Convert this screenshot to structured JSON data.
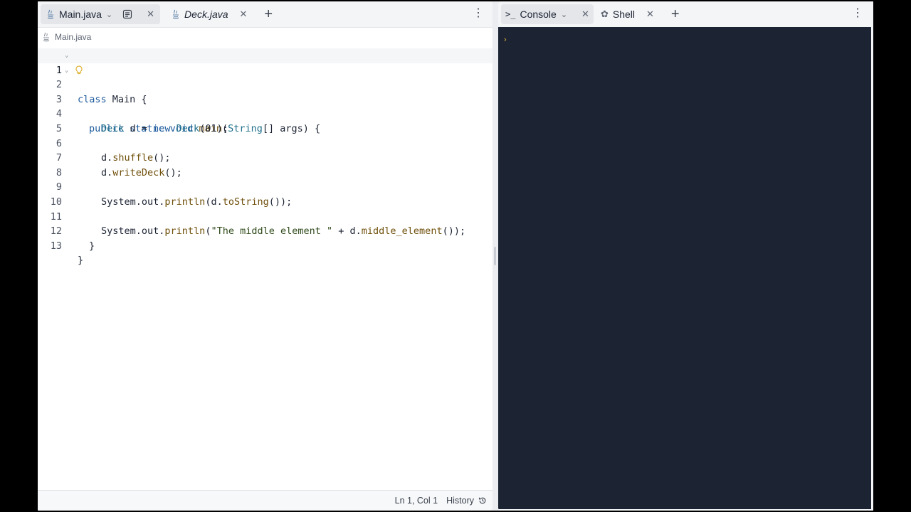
{
  "editor": {
    "tabs": [
      {
        "label": "Main.java",
        "active": true
      },
      {
        "label": "Deck.java",
        "active": false
      }
    ],
    "breadcrumb": "Main.java",
    "lines": [
      {
        "num": "1"
      },
      {
        "num": "2"
      },
      {
        "num": "3"
      },
      {
        "num": "4"
      },
      {
        "num": "5"
      },
      {
        "num": "6"
      },
      {
        "num": "7"
      },
      {
        "num": "8"
      },
      {
        "num": "9"
      },
      {
        "num": "10"
      },
      {
        "num": "11"
      },
      {
        "num": "12"
      },
      {
        "num": "13"
      }
    ],
    "code": {
      "l1_kw": "class",
      "l1_rest": " Main {",
      "l2_kw": "public static void",
      "l2_fn": " main",
      "l2_p1": "(",
      "l2_ty": "String",
      "l2_rest": "[] args) {",
      "l4_ty1": "Deck",
      "l4_mid": " d = ",
      "l4_kw": "new",
      "l4_ty2": " Deck",
      "l4_rest": "(01);",
      "l6_a": "d.",
      "l6_fn": "shuffle",
      "l6_b": "();",
      "l7_a": "d.",
      "l7_fn": "writeDeck",
      "l7_b": "();",
      "l9_a": "System.out.",
      "l9_fn": "println",
      "l9_b": "(d.",
      "l9_fn2": "toString",
      "l9_c": "());",
      "l11_a": "System.out.",
      "l11_fn": "println",
      "l11_b": "(",
      "l11_str": "\"The middle element \"",
      "l11_c": " + d.",
      "l11_fn2": "middle_element",
      "l11_d": "());",
      "l12": "}",
      "l13": "}"
    },
    "status": {
      "position": "Ln 1, Col 1",
      "history": "History"
    }
  },
  "console": {
    "tabs": [
      {
        "label": "Console",
        "active": true
      },
      {
        "label": "Shell",
        "active": false
      }
    ]
  },
  "colors": {
    "console_bg": "#1c2333",
    "accent_yellow": "#e0b43b"
  }
}
